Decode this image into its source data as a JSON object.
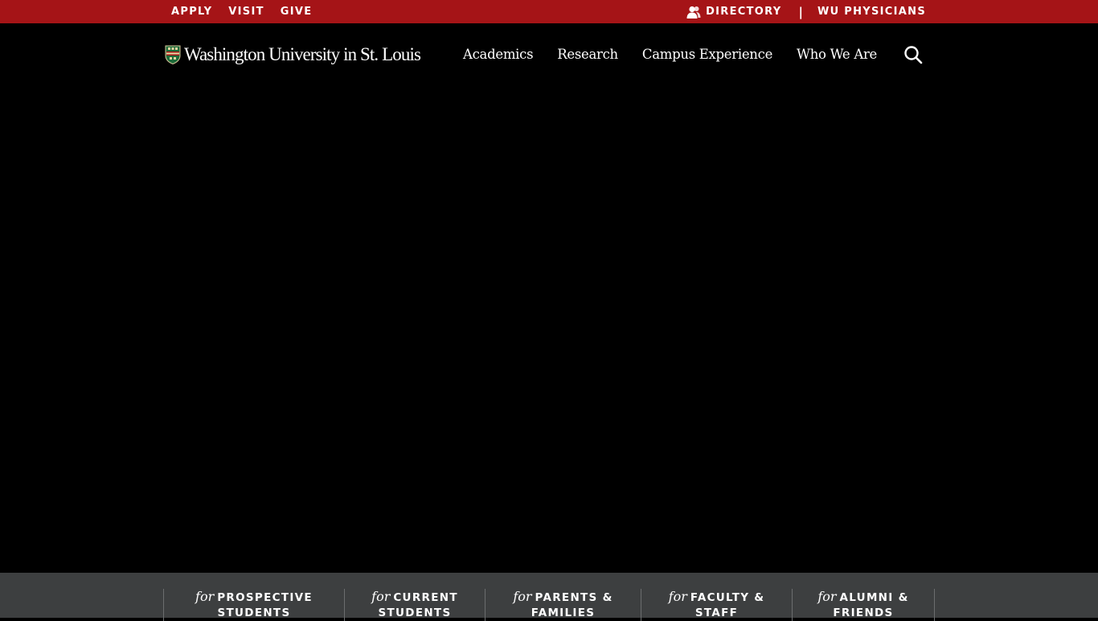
{
  "topbar": {
    "apply": "APPLY",
    "visit": "VISIT",
    "give": "GIVE",
    "directory": "DIRECTORY",
    "separator": "|",
    "physicians": "WU PHYSICIANS",
    "bg_color": "#a51417"
  },
  "header": {
    "logo_text": "Washington University in St. Louis",
    "nav": [
      "Academics",
      "Research",
      "Campus Experience",
      "Who We Are"
    ]
  },
  "audience": {
    "for_word": "for",
    "items": [
      {
        "line1": "PROSPECTIVE",
        "line2": "STUDENTS"
      },
      {
        "line1": "CURRENT",
        "line2": "STUDENTS"
      },
      {
        "line1": "PARENTS &",
        "line2": "FAMILIES"
      },
      {
        "line1": "FACULTY &",
        "line2": "STAFF"
      },
      {
        "line1": "ALUMNI &",
        "line2": "FRIENDS"
      }
    ]
  }
}
